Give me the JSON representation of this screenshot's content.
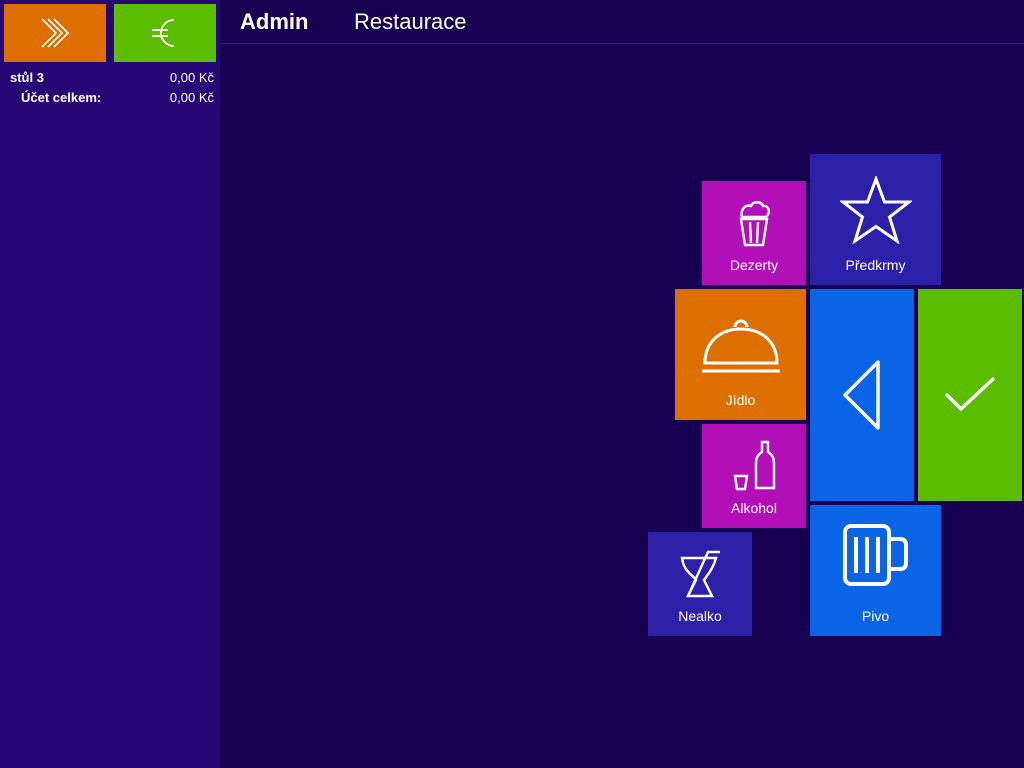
{
  "sidebar": {
    "forward_icon": "double-chevron-right-icon",
    "pay_icon": "euro-icon",
    "table_label": "stůl 3",
    "table_amount": "0,00 Kč",
    "total_label": "Účet celkem:",
    "total_amount": "0,00 Kč"
  },
  "header": {
    "user": "Admin",
    "section": "Restaurace"
  },
  "tiles": {
    "dezerty": "Dezerty",
    "predkrmy": "Předkrmy",
    "jidlo": "Jídlo",
    "alkohol": "Alkohol",
    "nealko": "Nealko",
    "pivo": "Pivo"
  },
  "colors": {
    "orange": "#dc6f00",
    "green": "#5cbc00",
    "magenta": "#b30fb8",
    "indigo": "#2c1fa8",
    "blue": "#0a64e6",
    "sidebar": "#260874",
    "background": "#170052"
  }
}
